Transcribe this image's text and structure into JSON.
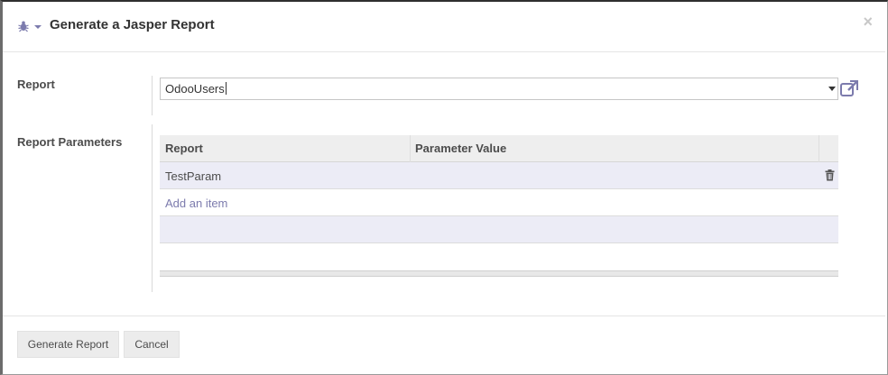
{
  "dialog": {
    "title": "Generate a Jasper Report",
    "close_label": "×",
    "debug_icon": "bug-icon",
    "accent_color": "#7c7bad"
  },
  "form": {
    "report_label": "Report",
    "report_value": "OdooUsers",
    "parameters_label": "Report Parameters"
  },
  "table": {
    "columns": [
      "Report",
      "Parameter Value"
    ],
    "rows": [
      {
        "report": "TestParam",
        "parameter_value": ""
      }
    ],
    "add_item_label": "Add an item"
  },
  "footer": {
    "generate_label": "Generate Report",
    "cancel_label": "Cancel"
  }
}
